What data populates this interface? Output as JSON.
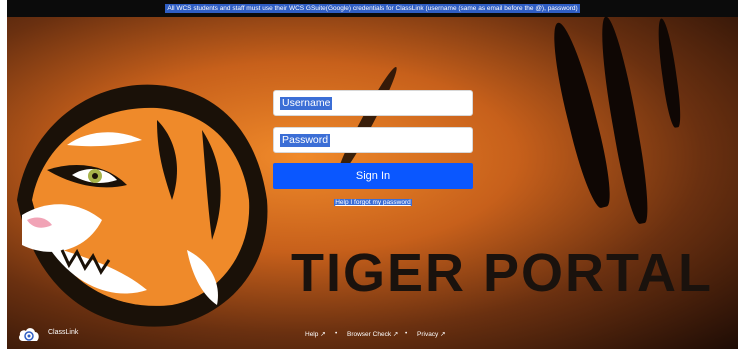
{
  "banner": {
    "text": "All WCS students and staff must use their WCS GSuite(Google) credentials for ClassLink (username (same as email before the @), password)"
  },
  "login": {
    "username_placeholder": "Username",
    "password_placeholder": "Password",
    "signin_label": "Sign In",
    "forgot_label": "Help I forgot my password"
  },
  "brand": {
    "portal_title": "TIGER PORTAL",
    "classlink_label": "ClassLink"
  },
  "footer": {
    "links": [
      "Help",
      "Browser Check",
      "Privacy"
    ],
    "separator": "•"
  },
  "colors": {
    "accent": "#0a57ff",
    "selection": "#3b6ed6",
    "banner_bg": "#0b0b0b"
  }
}
